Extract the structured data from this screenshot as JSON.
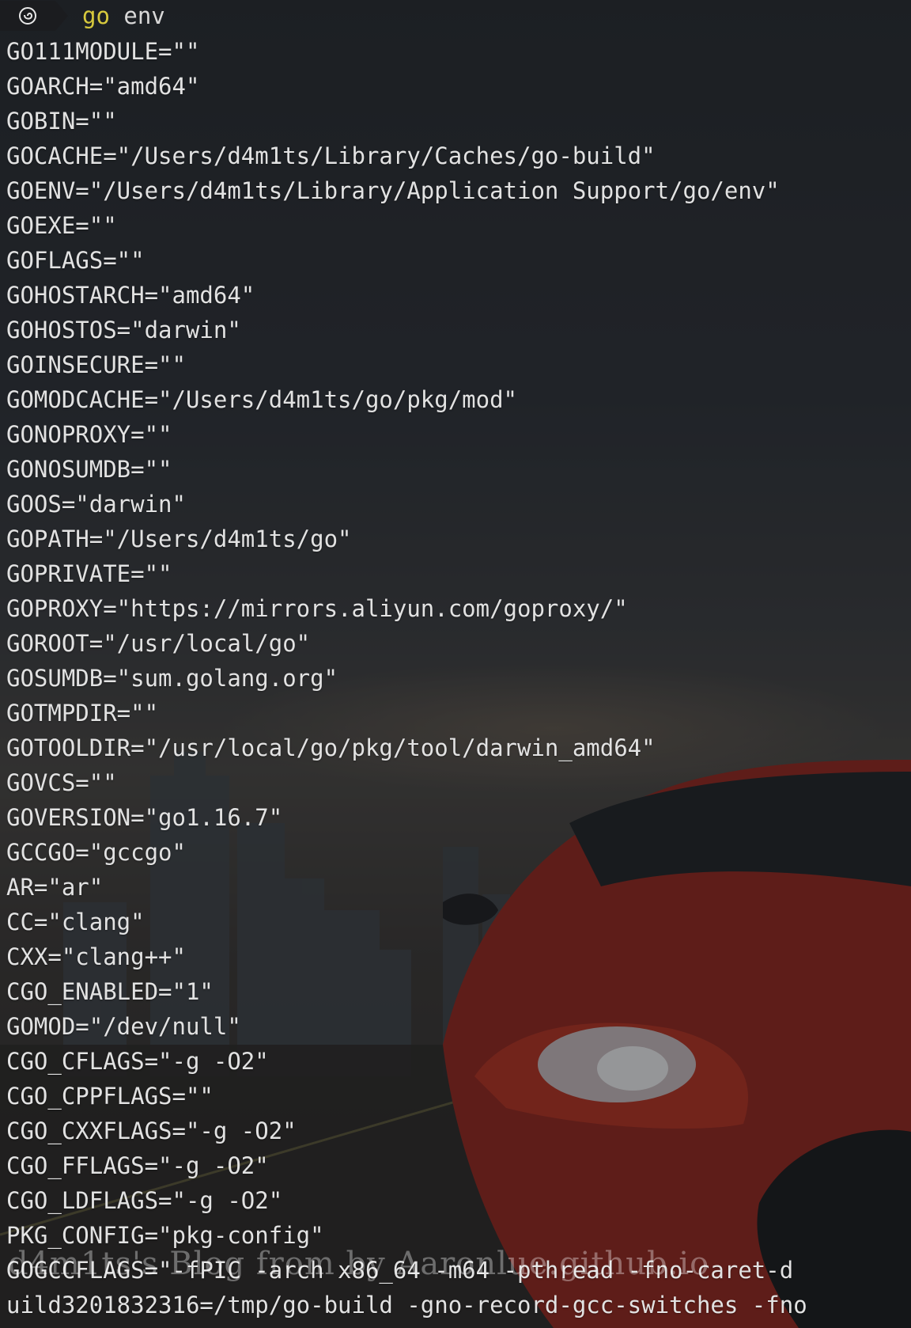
{
  "prompt": {
    "command_keyword": "go",
    "command_args": " env"
  },
  "output_lines": [
    "GO111MODULE=\"\"",
    "GOARCH=\"amd64\"",
    "GOBIN=\"\"",
    "GOCACHE=\"/Users/d4m1ts/Library/Caches/go-build\"",
    "GOENV=\"/Users/d4m1ts/Library/Application Support/go/env\"",
    "GOEXE=\"\"",
    "GOFLAGS=\"\"",
    "GOHOSTARCH=\"amd64\"",
    "GOHOSTOS=\"darwin\"",
    "GOINSECURE=\"\"",
    "GOMODCACHE=\"/Users/d4m1ts/go/pkg/mod\"",
    "GONOPROXY=\"\"",
    "GONOSUMDB=\"\"",
    "GOOS=\"darwin\"",
    "GOPATH=\"/Users/d4m1ts/go\"",
    "GOPRIVATE=\"\"",
    "GOPROXY=\"https://mirrors.aliyun.com/goproxy/\"",
    "GOROOT=\"/usr/local/go\"",
    "GOSUMDB=\"sum.golang.org\"",
    "GOTMPDIR=\"\"",
    "GOTOOLDIR=\"/usr/local/go/pkg/tool/darwin_amd64\"",
    "GOVCS=\"\"",
    "GOVERSION=\"go1.16.7\"",
    "GCCGO=\"gccgo\"",
    "AR=\"ar\"",
    "CC=\"clang\"",
    "CXX=\"clang++\"",
    "CGO_ENABLED=\"1\"",
    "GOMOD=\"/dev/null\"",
    "CGO_CFLAGS=\"-g -O2\"",
    "CGO_CPPFLAGS=\"\"",
    "CGO_CXXFLAGS=\"-g -O2\"",
    "CGO_FFLAGS=\"-g -O2\"",
    "CGO_LDFLAGS=\"-g -O2\"",
    "PKG_CONFIG=\"pkg-config\"",
    "GOGCCFLAGS=\"-fPIC -arch x86_64 -m64 -pthread -fno-caret-d",
    "uild3201832316=/tmp/go-build -gno-record-gcc-switches -fno"
  ],
  "watermark": "d4m1ts's Blog from by Aaronlue.github.io",
  "colors": {
    "keyword": "#d7c93d",
    "text": "#e2e2e2",
    "car": "#b8281c"
  },
  "icons": {
    "shell_icon": "terminal-swirl-icon"
  }
}
